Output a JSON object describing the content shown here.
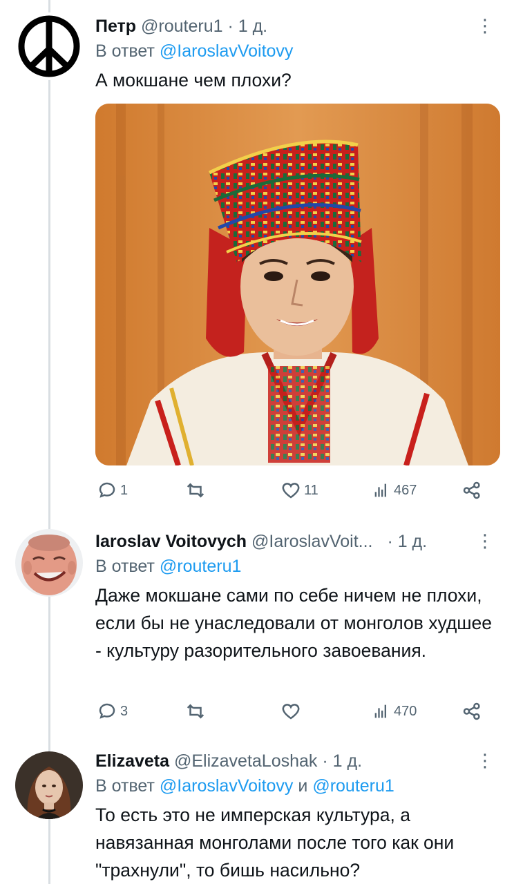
{
  "tweets": [
    {
      "name": "Петр",
      "handle": "@routeru1",
      "time": "· 1 д.",
      "reply_prefix": "В ответ",
      "reply_to": "@IaroslavVoitovy",
      "text": "А мокшане чем плохи?",
      "stats": {
        "replies": "1",
        "retweets": "",
        "likes": "11",
        "views": "467"
      },
      "avatar_icon": "peace-symbol-icon"
    },
    {
      "name": "Iaroslav Voitovych",
      "handle": "@IaroslavVoit...",
      "time": "· 1 д.",
      "reply_prefix": "В ответ",
      "reply_to": "@routeru1",
      "text": "Даже мокшане сами по себе ничем не плохи, если бы не унаследовали от монголов худшее - культуру разорительного завоевания.",
      "stats": {
        "replies": "3",
        "retweets": "",
        "likes": "",
        "views": "470"
      }
    },
    {
      "name": "Elizaveta",
      "handle": "@ElizavetaLoshak",
      "time": "· 1 д.",
      "reply_prefix": "В ответ",
      "reply_to": "@IaroslavVoitovy",
      "reply_and": "и",
      "reply_to_2": "@routeru1",
      "text": "То есть это не имперская культура, а навязанная монголами после того как они \"трахнули\", то бишь насильно?"
    }
  ],
  "more_glyph": "⋮",
  "colors": {
    "link": "#1d9bf0",
    "muted": "#536471",
    "text": "#0f1419",
    "thread_line": "#d9dee2"
  }
}
